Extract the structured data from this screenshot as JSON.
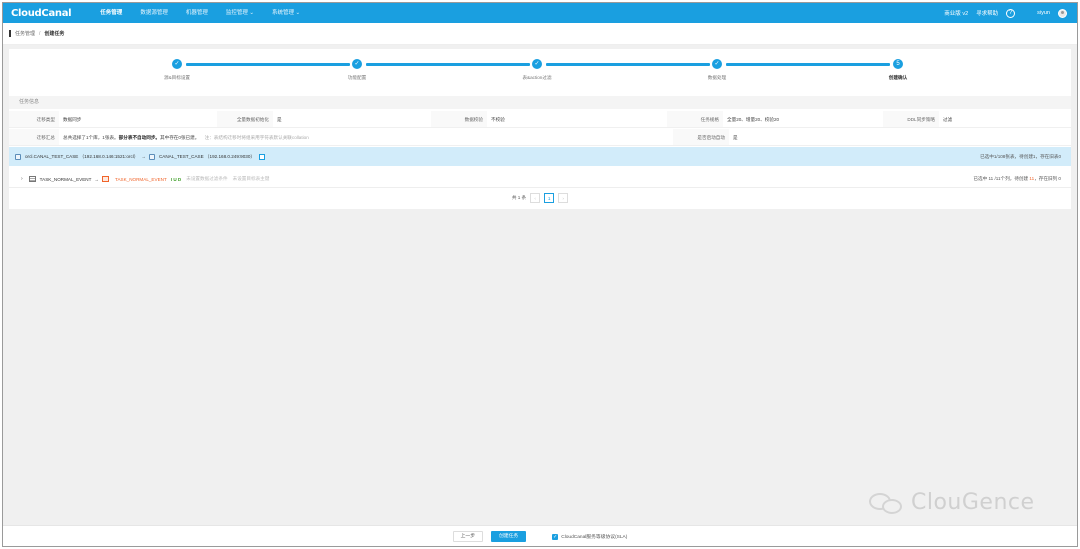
{
  "app": {
    "logo": "CloudCanal",
    "nav": [
      "任务管理",
      "数据源管理",
      "机器管理",
      "监控管理 ⌄",
      "系统管理 ⌄"
    ],
    "edition": "商业版 v2",
    "help": "寻求帮助",
    "help_icon_glyph": "?",
    "username": "siyun"
  },
  "breadcrumb": [
    "任务管理",
    "创建任务"
  ],
  "steps": [
    {
      "label": "源&目标设置",
      "icon": "✓"
    },
    {
      "label": "功能配置",
      "icon": "✓"
    },
    {
      "label": "表&action过滤",
      "icon": "✓"
    },
    {
      "label": "数据处理",
      "icon": "✓"
    },
    {
      "label": "创建确认",
      "icon": "5"
    }
  ],
  "info": {
    "section_title": "任务信息",
    "row1": [
      {
        "label": "迁移类型",
        "value": "数据同步"
      },
      {
        "label": "全量数据初始化",
        "value": "是"
      },
      {
        "label": "数据校验",
        "value": "不校验"
      },
      {
        "label": "任务规格",
        "value": "全量20、增量20、校验20"
      },
      {
        "label": "DDL同步策略",
        "value": "过滤"
      }
    ],
    "row2": {
      "label": "迁移汇总",
      "value_prefix": "总共选择了1个库，1张表。",
      "value_bold": "部分表不自动同步。",
      "value_suffix": "其中存在0张已建。",
      "hint": "注：表结构迁移时将组采用字符表默认关联collation",
      "auto_label": "是否启动自动",
      "auto_value": "是"
    }
  },
  "route": {
    "source": "orcl.CANAL_TEST_CASE （192.168.0.146:1521:orcl）",
    "arrow": "→",
    "target": "CANAL_TEST_CASE （192.168.0.249:9030）",
    "summary": "已选中1/108张表，待创建1，存在旧表0"
  },
  "table_row": {
    "expand": "›",
    "source_table": "TASK_NORMAL_EVENT",
    "arrow": "→",
    "target_table": "TASK_NORMAL_EVENT",
    "actions": "I U D",
    "hint1": "未设置数据过滤条件",
    "hint2": "未设置目标表主键",
    "summary_prefix": "已选中 11 /11个列，待创建 ",
    "summary_num": "11",
    "summary_suffix": "，存在旧列 0"
  },
  "pager": {
    "total": "共 1 条",
    "prev": "‹",
    "page": "1",
    "next": "›"
  },
  "footer": {
    "prev": "上一步",
    "create": "创建任务",
    "check": "✓",
    "agreement": "CloudCanal服务等级协议(SLA)"
  },
  "watermark": "ClouGence"
}
